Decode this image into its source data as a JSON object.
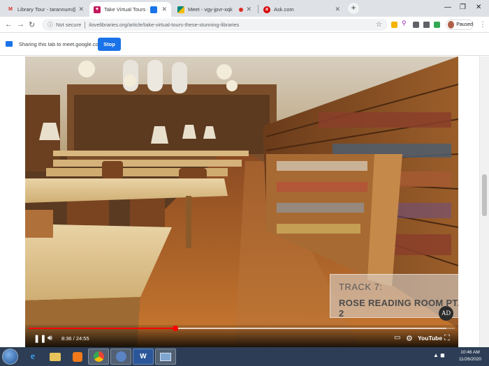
{
  "tabs": [
    {
      "title": "Library Tour - tarannum@theind",
      "favicon": "gmail-icon",
      "color": "#d93025"
    },
    {
      "title": "Take Virtual Tours of These Stunning Libraries",
      "favicon": "ilovelibraries-icon",
      "color": "#c2185b"
    },
    {
      "title": "Meet - vgy-jpvr-xqk",
      "favicon": "meet-icon",
      "color": "#00897b"
    },
    {
      "title": "Ask.com",
      "favicon": "ask-icon",
      "color": "#d50000"
    }
  ],
  "browser": {
    "security_label": "Not secure",
    "url": "ilovelibraries.org/article/take-virtual-tours-these-stunning-libraries",
    "profile_status": "Paused"
  },
  "share_bar": {
    "text": "Sharing this tab to meet.google.com",
    "stop_label": "Stop"
  },
  "video": {
    "overlay_line1": "TRACK 7:",
    "overlay_line2": "ROSE READING ROOM PT. 2",
    "badge": "AD",
    "current_time": "8:36",
    "duration": "24:55",
    "time_text": "8:36 / 24:55",
    "progress": 0.345,
    "buffered": 0.98,
    "platform_label": "YouTube"
  },
  "taskbar": {
    "apps": [
      "ie-icon",
      "explorer-icon",
      "media-player-icon",
      "chrome-icon",
      "chrome-alt-icon",
      "word-icon",
      "window-icon"
    ],
    "time": "10:46 AM",
    "date": "11/26/2020"
  }
}
